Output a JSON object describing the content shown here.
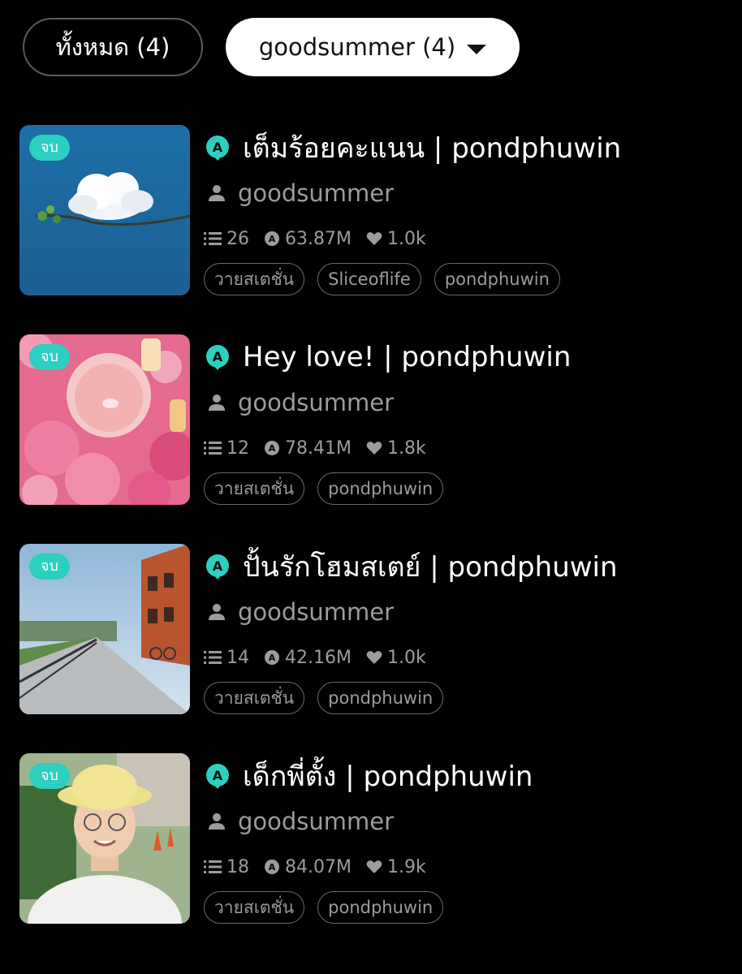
{
  "filters": {
    "all_label": "ทั้งหมด (4)",
    "selected_label": "goodsummer (4)"
  },
  "colors": {
    "background": "#000000",
    "accent": "#2CCFC0",
    "muted_text": "#9C9C9C"
  },
  "stories": [
    {
      "status": "จบ",
      "title": "เต็มร้อยคะแนน | pondphuwin",
      "author": "goodsummer",
      "chapters": "26",
      "views": "63.87M",
      "likes": "1.0k",
      "tags": [
        "วายสเตชั่น",
        "Sliceoflife",
        "pondphuwin"
      ],
      "cover": "sky-cloud-branch"
    },
    {
      "status": "จบ",
      "title": "Hey love! | pondphuwin",
      "author": "goodsummer",
      "chapters": "12",
      "views": "78.41M",
      "likes": "1.8k",
      "tags": [
        "วายสเตชั่น",
        "pondphuwin"
      ],
      "cover": "pink-lotus-drink"
    },
    {
      "status": "จบ",
      "title": "ปั้นรักโฮมสเตย์ | pondphuwin",
      "author": "goodsummer",
      "chapters": "14",
      "views": "42.16M",
      "likes": "1.0k",
      "tags": [
        "วายสเตชั่น",
        "pondphuwin"
      ],
      "cover": "riverside-street"
    },
    {
      "status": "จบ",
      "title": "เด็กพี่ตั้ง | pondphuwin",
      "author": "goodsummer",
      "chapters": "18",
      "views": "84.07M",
      "likes": "1.9k",
      "tags": [
        "วายสเตชั่น",
        "pondphuwin"
      ],
      "cover": "boy-bucket-hat"
    }
  ]
}
